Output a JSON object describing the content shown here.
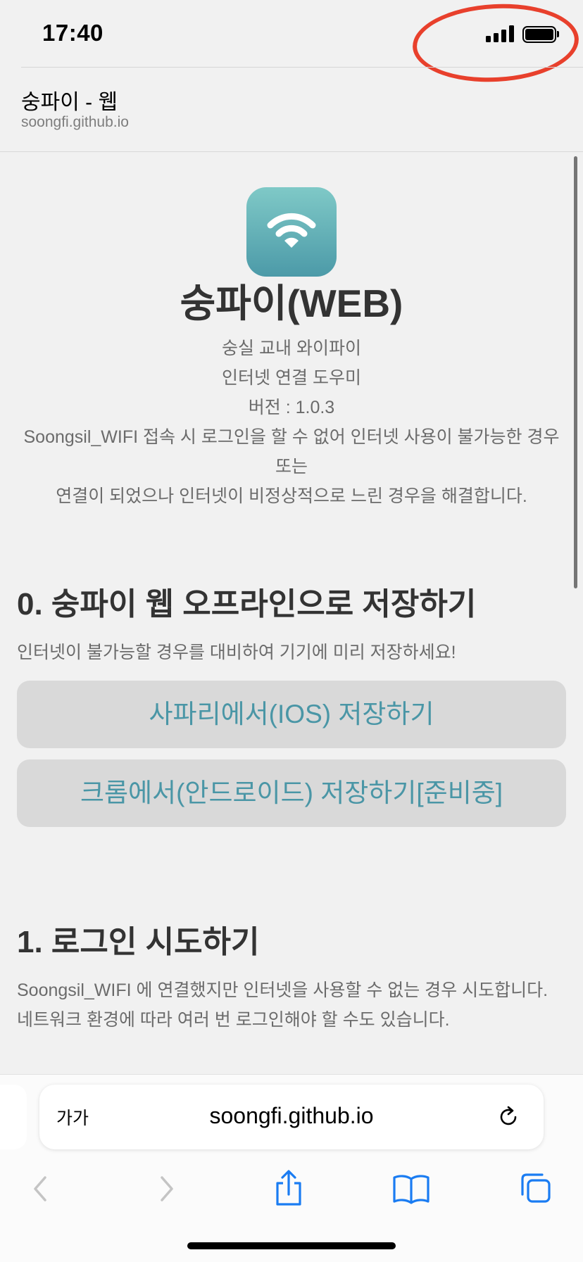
{
  "status_bar": {
    "time": "17:40"
  },
  "page_header": {
    "title": "숭파이 - 웹",
    "url": "soongfi.github.io"
  },
  "hero": {
    "app_icon": "wifi-icon",
    "title": "숭파이(WEB)",
    "subtitle_lines": [
      "숭실 교내 와이파이",
      "인터넷 연결 도우미",
      "버전 : 1.0.3",
      "Soongsil_WIFI 접속 시 로그인을 할 수 없어 인터넷 사용이 불가능한 경우 또는",
      "연결이 되었으나 인터넷이 비정상적으로 느린 경우을 해결합니다."
    ]
  },
  "section0": {
    "title": "0. 숭파이 웹 오프라인으로 저장하기",
    "description": "인터넷이 불가능할 경우를 대비하여 기기에 미리 저장하세요!",
    "buttons": [
      "사파리에서(IOS) 저장하기",
      "크롬에서(안드로이드) 저장하기[준비중]"
    ]
  },
  "section1": {
    "title": "1. 로그인 시도하기",
    "description_lines": [
      "Soongsil_WIFI 에 연결했지만 인터넷을 사용할 수 없는 경우 시도합니다.",
      "네트워크 환경에 따라 여러 번 로그인해야 할 수도 있습니다."
    ]
  },
  "safari": {
    "text_size_label": "가가",
    "address": "soongfi.github.io",
    "toolbar_icons": [
      "back-icon",
      "forward-icon",
      "share-icon",
      "bookmarks-icon",
      "tabs-icon"
    ]
  },
  "colors": {
    "accent": "#4a96a6",
    "icon_gradient_top": "#7fc9c7",
    "icon_gradient_bottom": "#4c9aa8",
    "annotation_circle": "#e8402c",
    "toolbar_blue": "#1a7cf2"
  }
}
